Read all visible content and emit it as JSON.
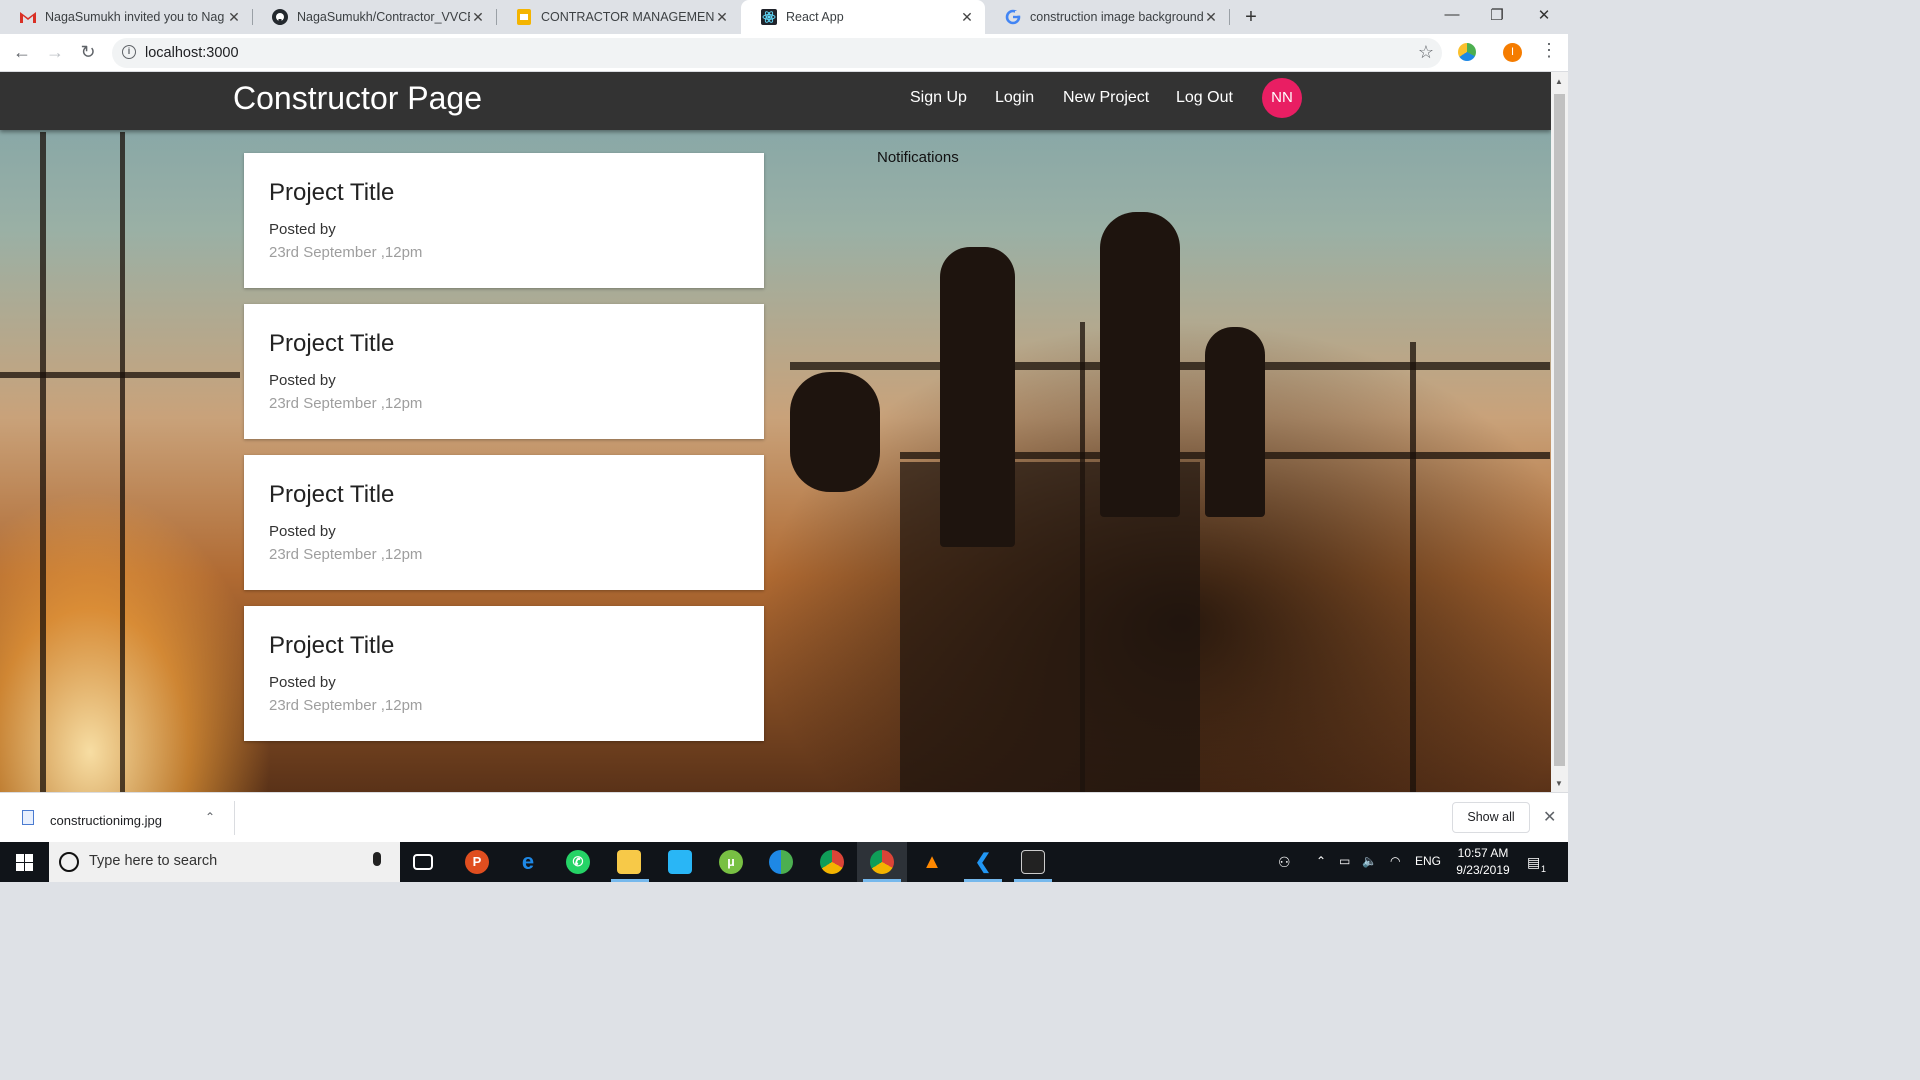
{
  "browser": {
    "tabs": [
      {
        "title": "NagaSumukh invited you to Nag",
        "icon": "gmail-icon",
        "active": false
      },
      {
        "title": "NagaSumukh/Contractor_VVCE",
        "icon": "github-icon",
        "active": false
      },
      {
        "title": "CONTRACTOR MANAGEMENT SY",
        "icon": "slides-icon",
        "active": false
      },
      {
        "title": "React App",
        "icon": "react-icon",
        "active": true
      },
      {
        "title": "construction image background",
        "icon": "google-icon",
        "active": false
      }
    ],
    "url": "localhost:3000",
    "profile_initial": "I"
  },
  "app": {
    "brand": "Constructor Page",
    "nav": {
      "signup": "Sign Up",
      "login": "Login",
      "new_project": "New Project",
      "logout": "Log Out"
    },
    "avatar_initials": "NN",
    "notifications_label": "Notifications",
    "projects": [
      {
        "title": "Project Title",
        "posted_by": "Posted by",
        "date": "23rd September ,12pm"
      },
      {
        "title": "Project Title",
        "posted_by": "Posted by",
        "date": "23rd September ,12pm"
      },
      {
        "title": "Project Title",
        "posted_by": "Posted by",
        "date": "23rd September ,12pm"
      },
      {
        "title": "Project Title",
        "posted_by": "Posted by",
        "date": "23rd September ,12pm"
      }
    ],
    "colors": {
      "appbar": "#333333",
      "avatar": "#e91e63"
    }
  },
  "downloads": {
    "filename": "constructionimg.jpg",
    "show_all": "Show all"
  },
  "taskbar": {
    "search_placeholder": "Type here to search",
    "lang": "ENG",
    "time": "10:57 AM",
    "date": "9/23/2019",
    "notification_count": "1"
  }
}
